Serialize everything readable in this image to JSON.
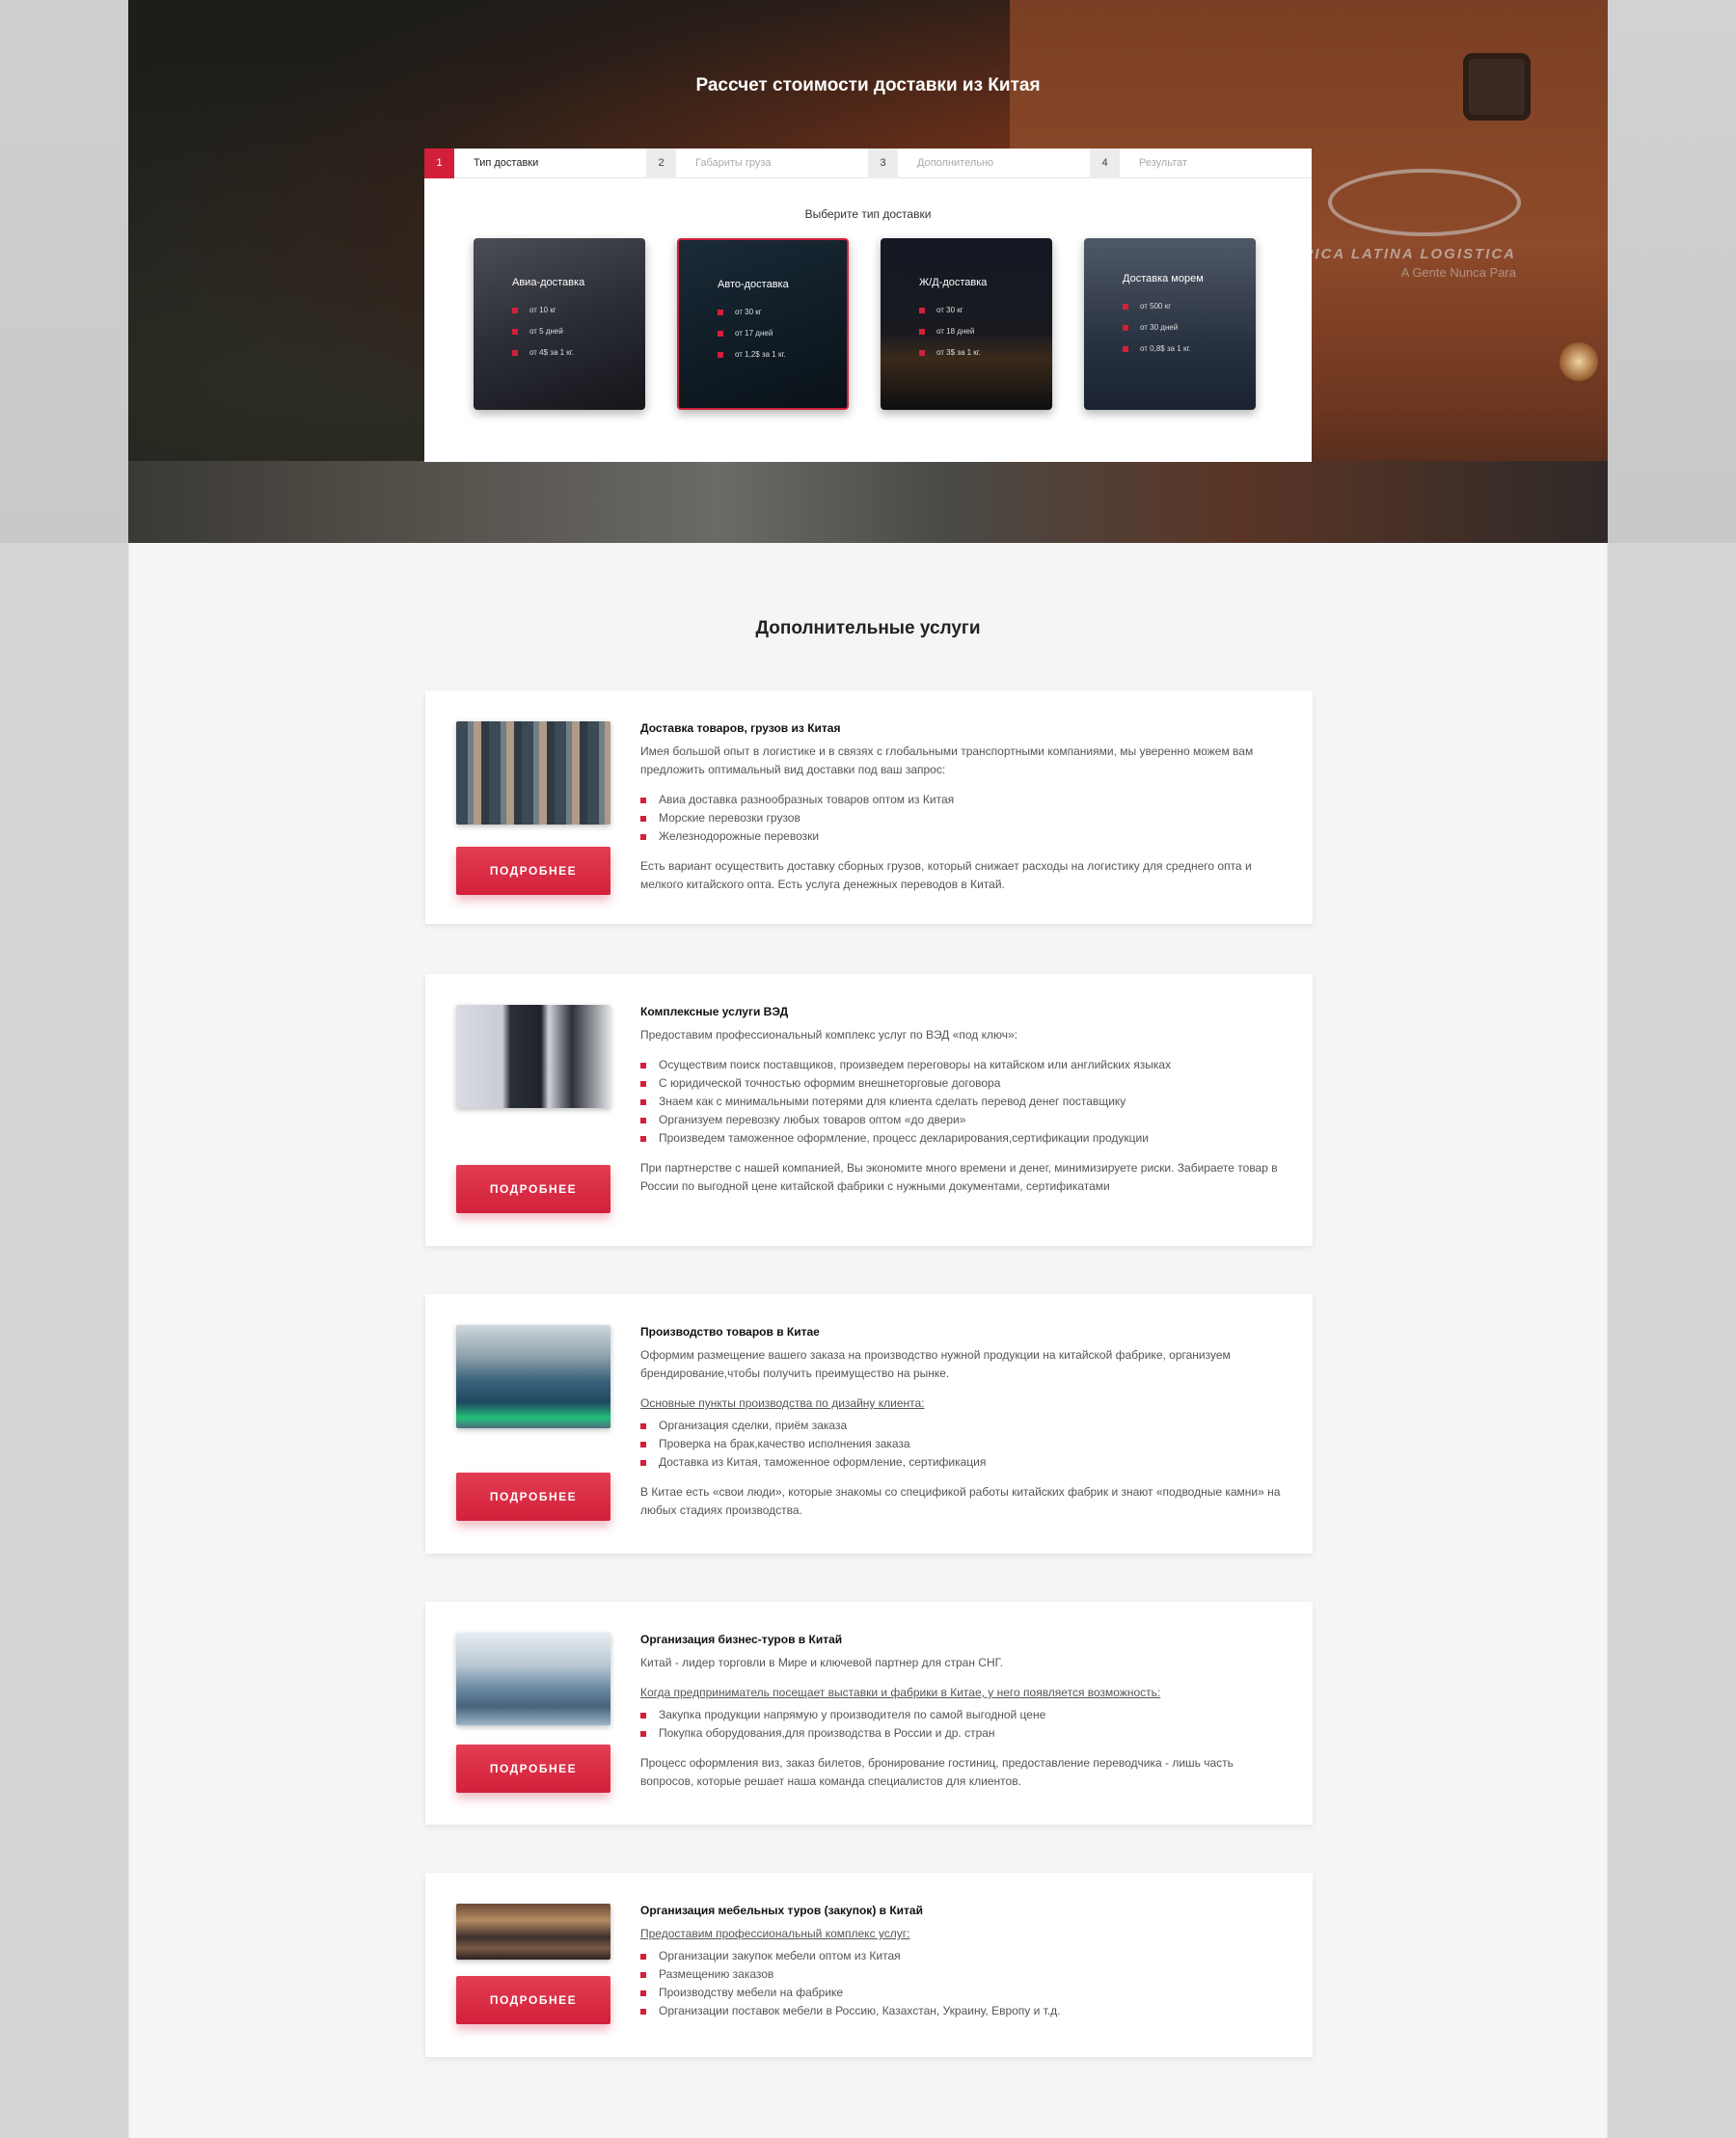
{
  "hero": {
    "title": "Рассчет стоимости доставки из Китая",
    "train_logo_text": "AMERICA LATINA LOGISTICA",
    "train_logo_sub": "A Gente Nunca Para"
  },
  "calculator": {
    "steps": [
      {
        "num": "1",
        "label": "Тип доставки",
        "active": true
      },
      {
        "num": "2",
        "label": "Габариты груза",
        "active": false
      },
      {
        "num": "3",
        "label": "Дополнительно",
        "active": false
      },
      {
        "num": "4",
        "label": "Результат",
        "active": false
      }
    ],
    "subtitle": "Выберите тип доставки",
    "types": [
      {
        "title": "Авиа-доставка",
        "features": [
          "от 10 кг",
          "от 5 дней",
          "от 4$ за 1 кг."
        ]
      },
      {
        "title": "Авто-доставка",
        "features": [
          "от 30 кг",
          "от 17 дней",
          "от 1,2$ за 1 кг."
        ],
        "selected": true
      },
      {
        "title": "Ж/Д-доставка",
        "features": [
          "от 30 кг",
          "от 18 дней",
          "от 3$ за 1 кг."
        ]
      },
      {
        "title": "Доставка морем",
        "features": [
          "от 500 кг",
          "от 30 дней",
          "от 0,8$ за 1 кг."
        ]
      }
    ]
  },
  "services": {
    "title": "Дополнительные услуги",
    "more_label": "ПОДРОБНЕЕ",
    "items": [
      {
        "title": "Доставка товаров, грузов из Китая",
        "intro": "Имея большой опыт в логистике и в связях с глобальными транспортными компаниями, мы уверенно можем вам предложить оптимальный вид доставки под ваш запрос:",
        "list": [
          "Авиа доставка разнообразных товаров оптом из Китая",
          "Морские перевозки грузов",
          "Железнодорожные перевозки"
        ],
        "outro": "Есть вариант осуществить доставку сборных грузов, который снижает расходы на логистику для среднего опта  и мелкого китайского опта. Есть услуга денежных переводов в Китай."
      },
      {
        "title": "Комплексные услуги ВЭД",
        "intro": "Предоставим профессиональный комплекс услуг по ВЭД «под ключ»:",
        "list": [
          "Осуществим поиск поставщиков, произведем переговоры на китайском или английских языках",
          "С юридической точностью оформим внешнеторговые договора",
          "Знаем как с минимальными потерями для клиента сделать перевод денег поставщику",
          "Организуем перевозку любых товаров оптом «до двери»",
          "Произведем таможенное оформление, процесс декларирования,сертификации продукции"
        ],
        "outro": "При партнерстве с нашей компанией, Вы экономите много времени и денег, минимизируете риски. Забираете товар в России по выгодной цене китайской фабрики с нужными документами, сертификатами"
      },
      {
        "title": "Производство товаров в Китае",
        "intro": "Оформим размещение вашего заказа на производство нужной продукции на китайской фабрике, организуем  брендирование,чтобы получить преимущество на рынке.",
        "underline": "Основные пункты производства по дизайну клиента:",
        "list": [
          "Организация сделки, приём заказа",
          "Проверка на брак,качество исполнения заказа",
          "Доставка из Китая, таможенное оформление, сертификация"
        ],
        "outro": "В Китае есть «свои люди», которые знакомы со спецификой работы китайских фабрик и знают «подводные камни» на любых стадиях производства."
      },
      {
        "title": "Организация бизнес-туров в Китай",
        "intro": "Китай - лидер торговли в Мире и ключевой партнер для стран СНГ.",
        "underline": "Когда предприниматель посещает выставки и фабрики в Китае, у него появляется возможность:",
        "list": [
          "Закупка продукции напрямую у производителя по самой выгодной цене",
          "Покупка оборудования,для производства в России и др. стран"
        ],
        "outro": "Процесс оформления виз, заказ билетов, бронирование гостиниц, предоставление переводчика - лишь часть вопросов, которые решает наша команда специалистов для клиентов."
      },
      {
        "title": "Организация мебельных туров (закупок) в Китай",
        "underline": "Предоставим профессиональный комплекс услуг:",
        "list": [
          "Организации закупок мебели оптом из Китая",
          "Размещению заказов",
          "Производству мебели на фабрике",
          "Организации поставок мебели в Россию, Казахстан, Украину, Европу и т.д."
        ]
      }
    ]
  }
}
